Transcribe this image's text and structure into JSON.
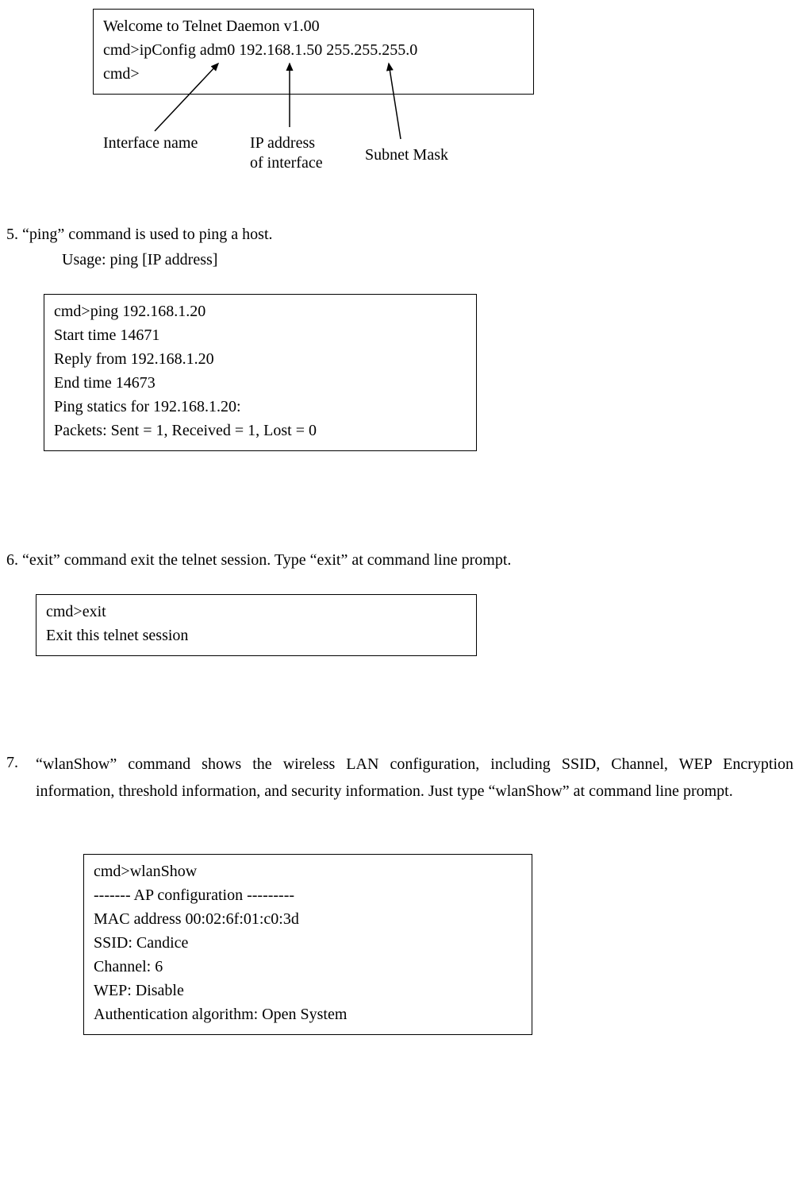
{
  "box1": {
    "line1": "Welcome to Telnet Daemon v1.00",
    "line2": "cmd>ipConfig adm0 192.168.1.50 255.255.255.0",
    "line3": "cmd>"
  },
  "annotations": {
    "interface_name": "Interface name",
    "ip_address_l1": "IP address",
    "ip_address_l2": "of interface",
    "subnet_mask": "Subnet Mask"
  },
  "section5": {
    "title": "5. “ping” command is used to ping a host.",
    "usage": "Usage: ping    [IP address]"
  },
  "box2": {
    "line1": "cmd>ping 192.168.1.20",
    "line2": "Start time 14671",
    "line3": "Reply from 192.168.1.20",
    "line4": "End time 14673",
    "line5": "Ping statics for 192.168.1.20:",
    "line6": "Packets: Sent = 1, Received = 1, Lost = 0"
  },
  "section6": {
    "title": "6. “exit” command exit the telnet session. Type “exit” at command line prompt."
  },
  "box3": {
    "line1": "cmd>exit",
    "line2": "Exit this telnet session"
  },
  "section7": {
    "number": "7.",
    "body": "“wlanShow” command shows the wireless LAN configuration, including SSID, Channel, WEP Encryption information, threshold information, and security information. Just type “wlanShow” at command line prompt."
  },
  "box4": {
    "line1": "cmd>wlanShow",
    "line2": "------- AP configuration ---------",
    "line3": "MAC address 00:02:6f:01:c0:3d",
    "line4": "SSID: Candice",
    "line5": "Channel: 6",
    "line6": "WEP: Disable",
    "line7": "Authentication algorithm: Open System"
  }
}
